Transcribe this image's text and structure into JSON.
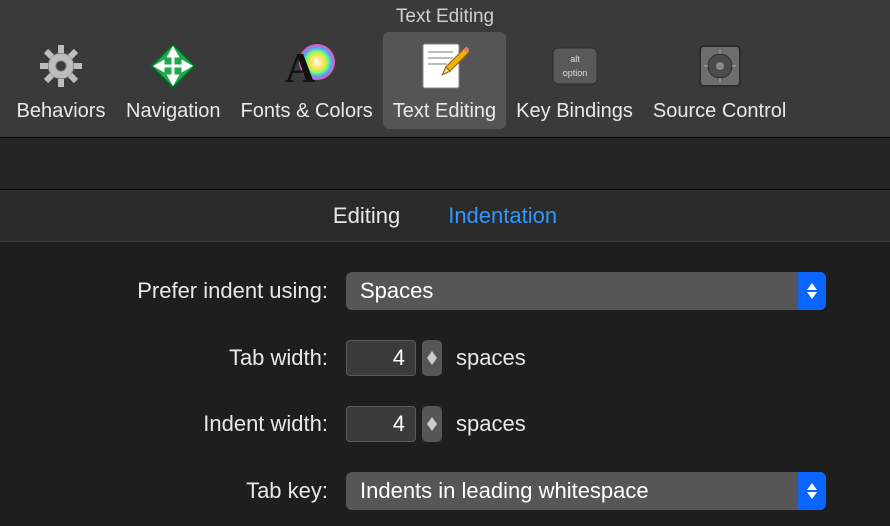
{
  "window_title": "Text Editing",
  "toolbar": {
    "items": [
      {
        "label": "Behaviors",
        "selected": false
      },
      {
        "label": "Navigation",
        "selected": false
      },
      {
        "label": "Fonts & Colors",
        "selected": false
      },
      {
        "label": "Text Editing",
        "selected": true
      },
      {
        "label": "Key Bindings",
        "selected": false
      },
      {
        "label": "Source Control",
        "selected": false
      }
    ]
  },
  "subtabs": {
    "items": [
      {
        "label": "Editing",
        "active": false
      },
      {
        "label": "Indentation",
        "active": true
      }
    ]
  },
  "form": {
    "prefer_indent_label": "Prefer indent using:",
    "prefer_indent_value": "Spaces",
    "tab_width_label": "Tab width:",
    "tab_width_value": "4",
    "tab_width_suffix": "spaces",
    "indent_width_label": "Indent width:",
    "indent_width_value": "4",
    "indent_width_suffix": "spaces",
    "tab_key_label": "Tab key:",
    "tab_key_value": "Indents in leading whitespace"
  },
  "colors": {
    "accent": "#0a66ff",
    "link": "#2f96ff"
  }
}
